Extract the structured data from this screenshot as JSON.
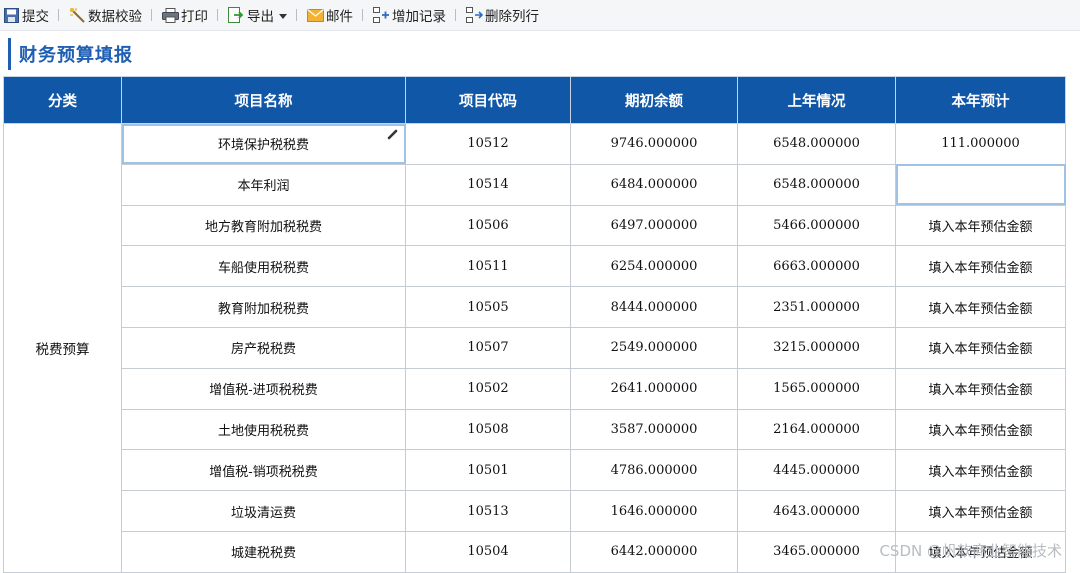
{
  "toolbar": {
    "items": [
      {
        "label": "提交",
        "icon": "save-icon"
      },
      {
        "label": "数据校验",
        "icon": "check-wand-icon"
      },
      {
        "label": "打印",
        "icon": "printer-icon"
      },
      {
        "label": "导出",
        "icon": "export-icon"
      },
      {
        "label": "邮件",
        "icon": "mail-icon"
      },
      {
        "label": "增加记录",
        "icon": "add-row-icon"
      },
      {
        "label": "删除列行",
        "icon": "delete-row-icon"
      }
    ]
  },
  "page_title": "财务预算填报",
  "table": {
    "headers": [
      "分类",
      "项目名称",
      "项目代码",
      "期初余额",
      "上年情况",
      "本年预计"
    ],
    "category": "税费预算",
    "placeholder": "填入本年预估金额",
    "rows": [
      {
        "name": "环境保护税税费",
        "code": "10512",
        "opening": "9746.000000",
        "last_year": "6548.000000",
        "estimate": "111.000000"
      },
      {
        "name": "本年利润",
        "code": "10514",
        "opening": "6484.000000",
        "last_year": "6548.000000",
        "estimate": ""
      },
      {
        "name": "地方教育附加税税费",
        "code": "10506",
        "opening": "6497.000000",
        "last_year": "5466.000000",
        "estimate": null
      },
      {
        "name": "车船使用税税费",
        "code": "10511",
        "opening": "6254.000000",
        "last_year": "6663.000000",
        "estimate": null
      },
      {
        "name": "教育附加税税费",
        "code": "10505",
        "opening": "8444.000000",
        "last_year": "2351.000000",
        "estimate": null
      },
      {
        "name": "房产税税费",
        "code": "10507",
        "opening": "2549.000000",
        "last_year": "3215.000000",
        "estimate": null
      },
      {
        "name": "增值税-进项税税费",
        "code": "10502",
        "opening": "2641.000000",
        "last_year": "1565.000000",
        "estimate": null
      },
      {
        "name": "土地使用税税费",
        "code": "10508",
        "opening": "3587.000000",
        "last_year": "2164.000000",
        "estimate": null
      },
      {
        "name": "增值税-销项税税费",
        "code": "10501",
        "opening": "4786.000000",
        "last_year": "4445.000000",
        "estimate": null
      },
      {
        "name": "垃圾清运费",
        "code": "10513",
        "opening": "1646.000000",
        "last_year": "4643.000000",
        "estimate": null
      },
      {
        "name": "城建税税费",
        "code": "10504",
        "opening": "6442.000000",
        "last_year": "3465.000000",
        "estimate": null
      }
    ]
  },
  "watermark": "CSDN @帆软商业智能技术",
  "colors": {
    "header_bg": "#1157a8",
    "title": "#1f5fb3",
    "placeholder": "#c5c8cc",
    "active_border": "#9fc2e5"
  }
}
